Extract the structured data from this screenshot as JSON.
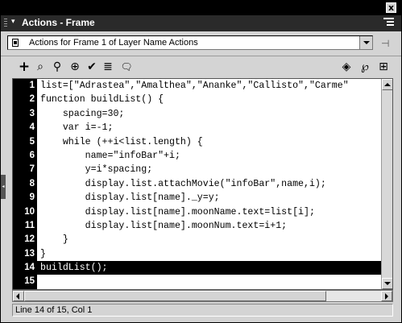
{
  "panel": {
    "close_glyph": "x",
    "title": "Actions - Frame",
    "collapse_glyph": "▾"
  },
  "script_selector": {
    "selected": "Actions for Frame 1 of Layer Name Actions"
  },
  "toolbar": {
    "items": [
      {
        "name": "add-action-icon",
        "glyph": "+"
      },
      {
        "name": "find-icon",
        "glyph": "⌕"
      },
      {
        "name": "find-replace-icon",
        "glyph": "⚲"
      },
      {
        "name": "insert-target-path-icon",
        "glyph": "⊕"
      },
      {
        "name": "check-syntax-icon",
        "glyph": "✔"
      },
      {
        "name": "auto-format-icon",
        "glyph": "≣"
      },
      {
        "name": "code-hint-icon",
        "glyph": "🗨"
      },
      {
        "name": "reference-icon",
        "glyph": "◈"
      },
      {
        "name": "debug-options-icon",
        "glyph": "℘"
      },
      {
        "name": "view-options-icon",
        "glyph": "⊞"
      }
    ]
  },
  "editor": {
    "current_line": 14,
    "lines": [
      {
        "n": "1",
        "code": "list=[\"Adrastea\",\"Amalthea\",\"Ananke\",\"Callisto\",\"Carme\""
      },
      {
        "n": "2",
        "code": "function buildList() {"
      },
      {
        "n": "3",
        "code": "    spacing=30;"
      },
      {
        "n": "4",
        "code": "    var i=-1;"
      },
      {
        "n": "5",
        "code": "    while (++i<list.length) {"
      },
      {
        "n": "6",
        "code": "        name=\"infoBar\"+i;"
      },
      {
        "n": "7",
        "code": "        y=i*spacing;"
      },
      {
        "n": "8",
        "code": "        display.list.attachMovie(\"infoBar\",name,i);"
      },
      {
        "n": "9",
        "code": "        display.list[name]._y=y;"
      },
      {
        "n": "10",
        "code": "        display.list[name].moonName.text=list[i];"
      },
      {
        "n": "11",
        "code": "        display.list[name].moonNum.text=i+1;"
      },
      {
        "n": "12",
        "code": "    }"
      },
      {
        "n": "13",
        "code": "}"
      },
      {
        "n": "14",
        "code": "buildList();"
      },
      {
        "n": "15",
        "code": ""
      }
    ]
  },
  "status": {
    "text": "Line 14 of 15, Col 1"
  }
}
